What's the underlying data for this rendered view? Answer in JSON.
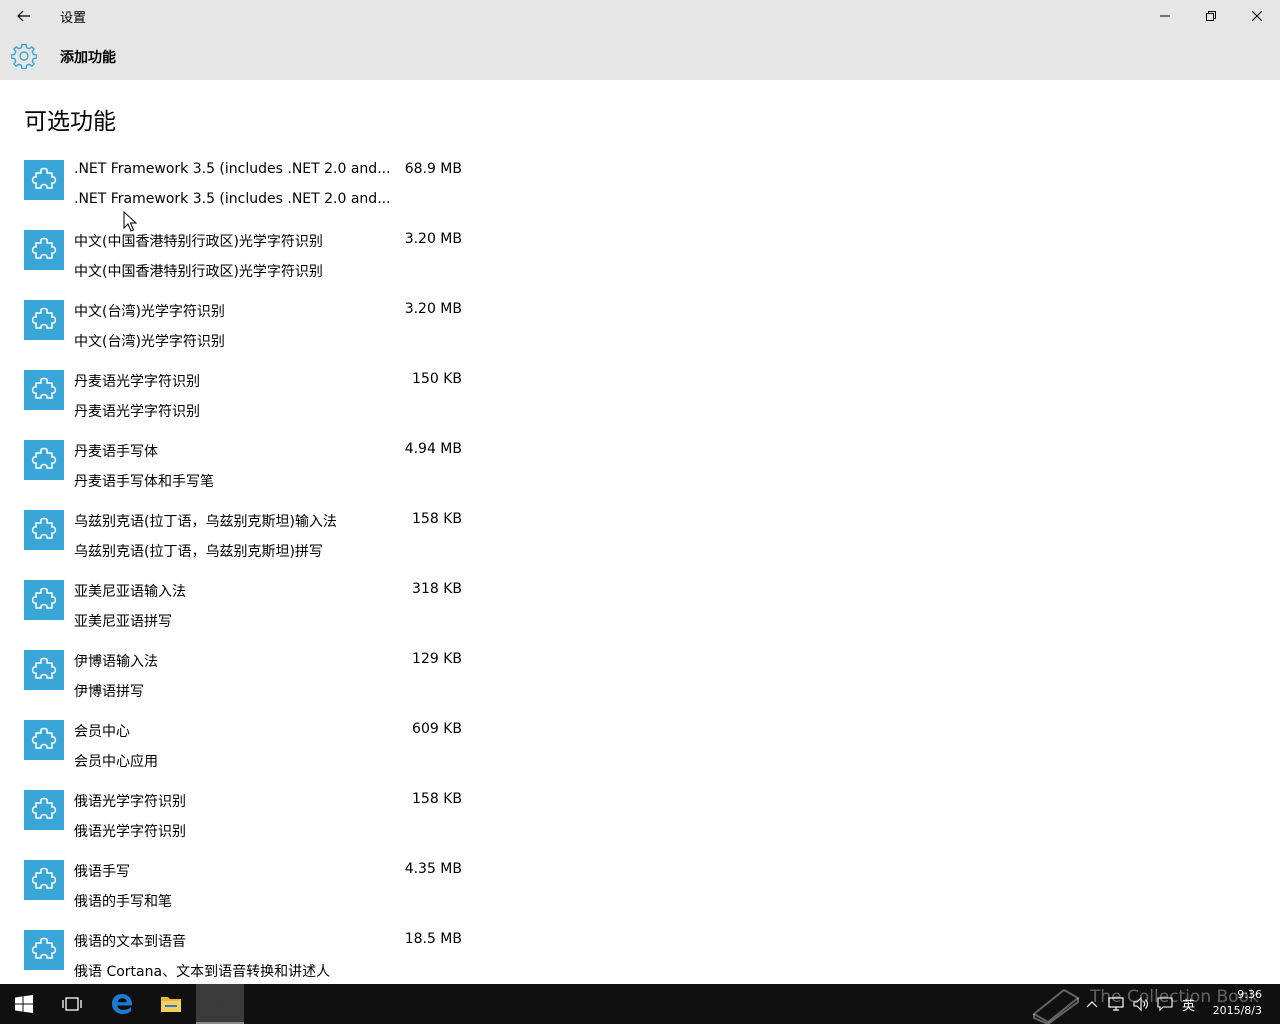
{
  "window": {
    "title": "设置"
  },
  "header": {
    "title": "添加功能"
  },
  "section": {
    "title": "可选功能"
  },
  "features": [
    {
      "name": ".NET Framework 3.5 (includes .NET 2.0 and...",
      "description": ".NET Framework 3.5 (includes .NET 2.0 and...",
      "size": "68.9 MB"
    },
    {
      "name": "中文(中国香港特别行政区)光学字符识别",
      "description": "中文(中国香港特别行政区)光学字符识别",
      "size": "3.20 MB"
    },
    {
      "name": "中文(台湾)光学字符识别",
      "description": "中文(台湾)光学字符识别",
      "size": "3.20 MB"
    },
    {
      "name": "丹麦语光学字符识别",
      "description": "丹麦语光学字符识别",
      "size": "150 KB"
    },
    {
      "name": "丹麦语手写体",
      "description": "丹麦语手写体和手写笔",
      "size": "4.94 MB"
    },
    {
      "name": "乌兹别克语(拉丁语，乌兹别克斯坦)输入法",
      "description": "乌兹别克语(拉丁语，乌兹别克斯坦)拼写",
      "size": "158 KB"
    },
    {
      "name": "亚美尼亚语输入法",
      "description": "亚美尼亚语拼写",
      "size": "318 KB"
    },
    {
      "name": "伊博语输入法",
      "description": "伊博语拼写",
      "size": "129 KB"
    },
    {
      "name": "会员中心",
      "description": "会员中心应用",
      "size": "609 KB"
    },
    {
      "name": "俄语光学字符识别",
      "description": "俄语光学字符识别",
      "size": "158 KB"
    },
    {
      "name": "俄语手写",
      "description": "俄语的手写和笔",
      "size": "4.35 MB"
    },
    {
      "name": "俄语的文本到语音",
      "description": "俄语 Cortana、文本到语音转换和讲述人",
      "size": "18.5 MB"
    }
  ],
  "taskbar": {
    "time": "9:36",
    "date": "2015/8/3",
    "ime": "英",
    "watermark": "The Collection Book"
  },
  "colors": {
    "accent": "#3aa6d8",
    "chrome": "#e6e6e6",
    "taskbar": "#101010"
  }
}
